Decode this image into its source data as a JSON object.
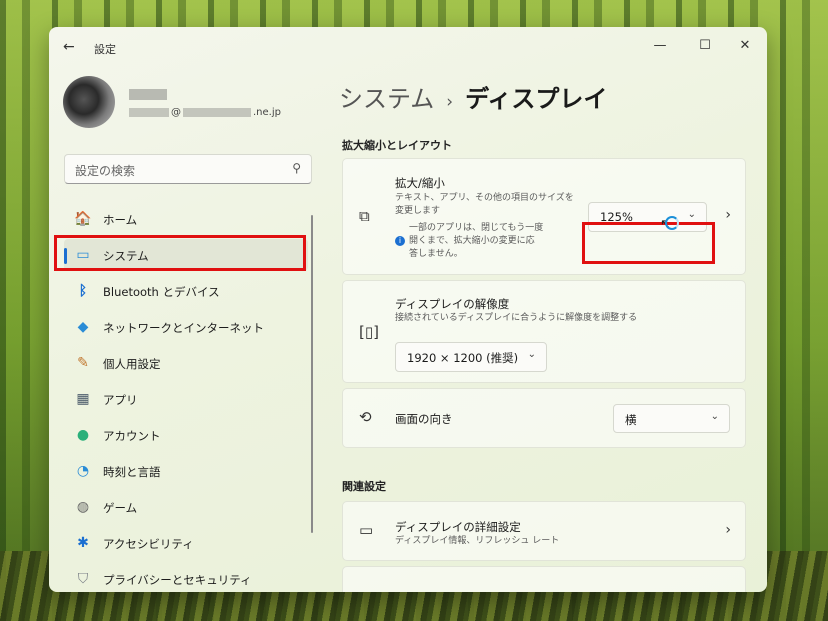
{
  "window": {
    "title": "設定",
    "back": "←",
    "minimize": "—",
    "maximize": "☐",
    "close": "✕"
  },
  "profile": {
    "email_at": "@",
    "email_domain": ".ne.jp"
  },
  "search": {
    "placeholder": "設定の検索"
  },
  "sidebar": {
    "items": [
      {
        "label": "ホーム",
        "icon": "🏠"
      },
      {
        "label": "システム",
        "icon": "▭"
      },
      {
        "label": "Bluetooth とデバイス",
        "icon": "ᛒ"
      },
      {
        "label": "ネットワークとインターネット",
        "icon": "◆"
      },
      {
        "label": "個人用設定",
        "icon": "✎"
      },
      {
        "label": "アプリ",
        "icon": "▦"
      },
      {
        "label": "アカウント",
        "icon": "●"
      },
      {
        "label": "時刻と言語",
        "icon": "◔"
      },
      {
        "label": "ゲーム",
        "icon": "◍"
      },
      {
        "label": "アクセシビリティ",
        "icon": "✱"
      },
      {
        "label": "プライバシーとセキュリティ",
        "icon": "⛉"
      }
    ],
    "selected": "システム"
  },
  "breadcrumb": {
    "parent": "システム",
    "sep": "›",
    "current": "ディスプレイ"
  },
  "scale_section": {
    "heading": "拡大縮小とレイアウト",
    "scale": {
      "title": "拡大/縮小",
      "sub1": "テキスト、アプリ、その他の項目のサイズを",
      "sub2": "変更します",
      "note1": "一部のアプリは、閉じてもう一度",
      "note2": "開くまで、拡大縮小の変更に応",
      "note3": "答しません。",
      "value": "125%"
    },
    "resolution": {
      "title": "ディスプレイの解像度",
      "sub": "接続されているディスプレイに合うように解像度を調整する",
      "value": "1920 × 1200 (推奨)"
    },
    "orientation": {
      "title": "画面の向き",
      "value": "横"
    }
  },
  "related": {
    "heading": "関連設定",
    "advanced": {
      "title": "ディスプレイの詳細設定",
      "sub": "ディスプレイ情報、リフレッシュ レート"
    }
  },
  "colors": {
    "highlight": "#e01010",
    "accent": "#1b6fd1"
  }
}
